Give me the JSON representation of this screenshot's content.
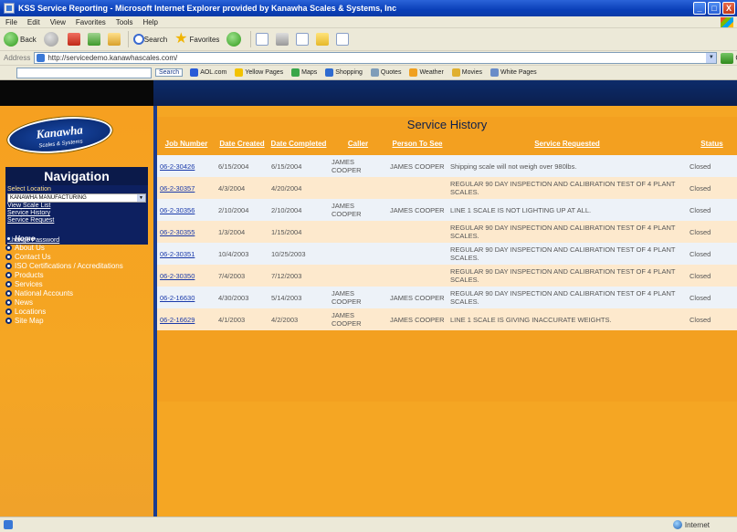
{
  "window": {
    "title": "KSS Service Reporting - Microsoft Internet Explorer provided by Kanawha Scales & Systems, Inc",
    "min": "_",
    "max": "□",
    "close": "X"
  },
  "menu": [
    "File",
    "Edit",
    "View",
    "Favorites",
    "Tools",
    "Help"
  ],
  "toolbar": {
    "back": "Back",
    "search": "Search",
    "favorites": "Favorites"
  },
  "address": {
    "label": "Address",
    "url": "http://servicedemo.kanawhascales.com/",
    "go": "Go"
  },
  "linksbar": {
    "search_btn": "Search",
    "items": [
      "AOL.com",
      "Yellow Pages",
      "Maps",
      "Shopping",
      "Quotes",
      "Weather",
      "Movies",
      "White Pages"
    ]
  },
  "logo": {
    "name": "Kanawha",
    "tagline": "Scales & Systems"
  },
  "nav": {
    "title": "Navigation",
    "select_label": "Select Location",
    "select_value": "KANAWHA MANUFACTURING",
    "links": [
      "View Scale List",
      "Service History",
      "Service Request"
    ],
    "change_password": "Change Password"
  },
  "sidenav": [
    "Home",
    "About Us",
    "Contact Us",
    "ISO Certifications / Accreditations",
    "Products",
    "Services",
    "National Accounts",
    "News",
    "Locations",
    "Site Map"
  ],
  "service_history": {
    "title": "Service History",
    "columns": [
      "Job Number",
      "Date Created",
      "Date Completed",
      "Caller",
      "Person To See",
      "Service Requested",
      "Status"
    ],
    "rows": [
      [
        "06-2-30426",
        "6/15/2004",
        "6/15/2004",
        "JAMES COOPER",
        "JAMES COOPER",
        "Shipping scale will not weigh over 980lbs.",
        "Closed"
      ],
      [
        "06-2-30357",
        "4/3/2004",
        "4/20/2004",
        "",
        "",
        "REGULAR 90 DAY INSPECTION AND CALIBRATION TEST OF 4 PLANT SCALES.",
        "Closed"
      ],
      [
        "06-2-30356",
        "2/10/2004",
        "2/10/2004",
        "JAMES COOPER",
        "JAMES COOPER",
        "LINE 1 SCALE IS NOT LIGHTING UP AT ALL.",
        "Closed"
      ],
      [
        "06-2-30355",
        "1/3/2004",
        "1/15/2004",
        "",
        "",
        "REGULAR 90 DAY INSPECTION AND CALIBRATION TEST OF 4 PLANT SCALES.",
        "Closed"
      ],
      [
        "06-2-30351",
        "10/4/2003",
        "10/25/2003",
        "",
        "",
        "REGULAR 90 DAY INSPECTION AND CALIBRATION TEST OF 4 PLANT SCALES.",
        "Closed"
      ],
      [
        "06-2-30350",
        "7/4/2003",
        "7/12/2003",
        "",
        "",
        "REGULAR 90 DAY INSPECTION AND CALIBRATION TEST OF 4 PLANT SCALES.",
        "Closed"
      ],
      [
        "06-2-16630",
        "4/30/2003",
        "5/14/2003",
        "JAMES COOPER",
        "JAMES COOPER",
        "REGULAR 90 DAY INSPECTION AND CALIBRATION TEST OF 4 PLANT SCALES.",
        "Closed"
      ],
      [
        "06-2-16629",
        "4/1/2003",
        "4/2/2003",
        "JAMES COOPER",
        "JAMES COOPER",
        "LINE 1 SCALE IS GIVING INACCURATE WEIGHTS.",
        "Closed"
      ]
    ]
  },
  "status": {
    "zone": "Internet"
  }
}
